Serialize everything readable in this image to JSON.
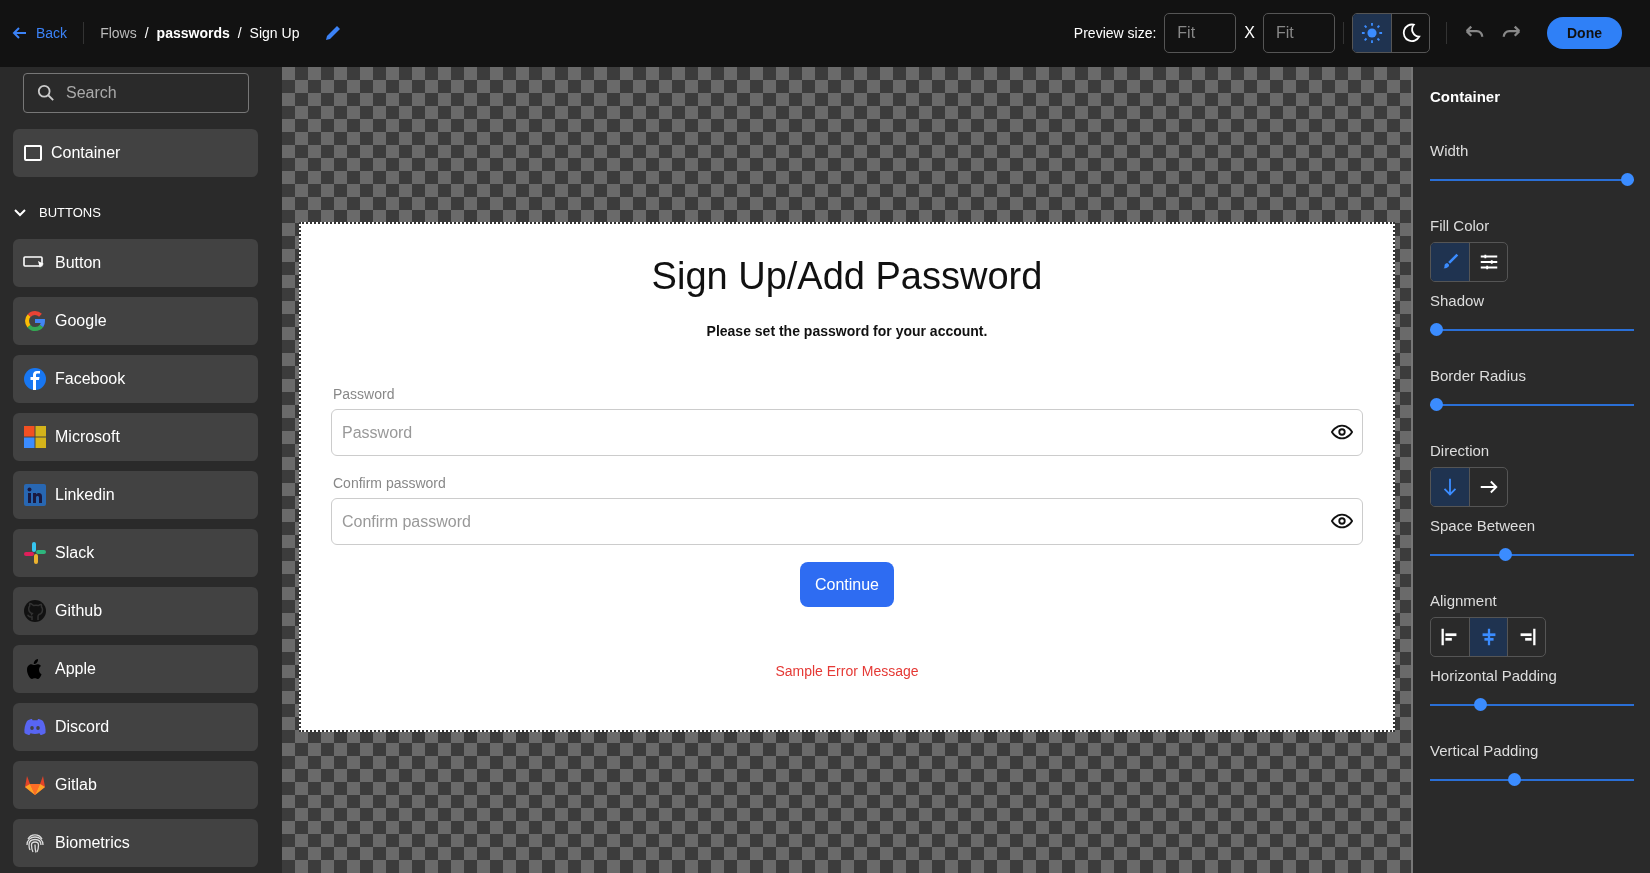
{
  "topbar": {
    "back": "Back",
    "breadcrumb": [
      {
        "kind": "link",
        "text": "Flows"
      },
      {
        "kind": "separator",
        "text": "/"
      },
      {
        "kind": "crumb",
        "text": "passwords"
      },
      {
        "kind": "separator",
        "text": "/"
      },
      {
        "kind": "crumb",
        "text": "Sign Up"
      }
    ],
    "preview_label": "Preview size:",
    "width_placeholder": "Fit",
    "times": "X",
    "height_placeholder": "Fit",
    "theme_options": [
      {
        "selected": true
      },
      {
        "selected": false
      }
    ],
    "done": "Done"
  },
  "sidebar": {
    "search": {
      "placeholder": "Search"
    },
    "container_item": "Container",
    "section": {
      "title": "BUTTONS",
      "expanded": true,
      "items": [
        "Button",
        "Google",
        "Facebook",
        "Microsoft",
        "Linkedin",
        "Slack",
        "Github",
        "Apple",
        "Discord",
        "Gitlab",
        "Biometrics"
      ]
    }
  },
  "form": {
    "title": "Sign Up/Add Password",
    "subtitle": "Please set the password for your account.",
    "fields": [
      {
        "label": "Password",
        "placeholder": "Password"
      },
      {
        "label": "Confirm password",
        "placeholder": "Confirm password"
      }
    ],
    "button": "Continue",
    "error": "Sample Error Message"
  },
  "panel": {
    "title": "Container",
    "controls": [
      {
        "kind": "slider",
        "label": "Width",
        "level": 1
      },
      {
        "kind": "segmented",
        "label": "Fill Color",
        "options": [
          {
            "selected": true
          },
          {
            "selected": false
          }
        ]
      },
      {
        "kind": "slider",
        "label": "Shadow",
        "level": 0
      },
      {
        "kind": "slider",
        "label": "Border Radius",
        "level": 0
      },
      {
        "kind": "segmented",
        "label": "Direction",
        "options": [
          {
            "selected": true
          },
          {
            "selected": false
          }
        ]
      },
      {
        "kind": "slider",
        "label": "Space Between",
        "level": 0.36
      },
      {
        "kind": "segmented",
        "label": "Alignment",
        "options": [
          {
            "selected": false
          },
          {
            "selected": true
          },
          {
            "selected": false
          }
        ]
      },
      {
        "kind": "slider",
        "label": "Horizontal Padding",
        "level": 0.23
      },
      {
        "kind": "slider",
        "label": "Vertical Padding",
        "level": 0.41
      }
    ]
  }
}
